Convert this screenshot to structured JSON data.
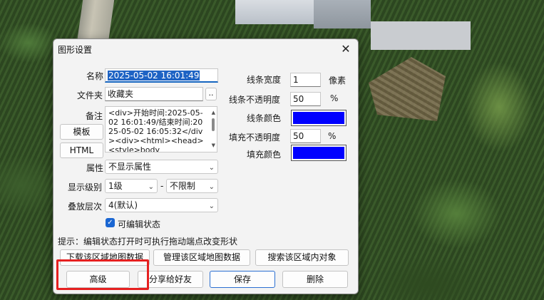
{
  "dialog": {
    "title": "图形设置",
    "close_glyph": "✕",
    "name_label": "名称",
    "name_value": "2025-05-02 16:01:49",
    "folder_label": "文件夹",
    "folder_value": "收藏夹",
    "folder_browse": "..",
    "note_label": "备注",
    "note_value": "<div>开始时间:2025-05-02 16:01:49/结束时间:2025-05-02 16:05:32</div><div><html><head><style>body",
    "template_button": "模板",
    "html_button": "HTML",
    "attr_label": "属性",
    "attr_value": "不显示属性",
    "level_label": "显示级别",
    "level_min": "1级",
    "level_sep": "-",
    "level_max": "不限制",
    "stack_label": "叠放层次",
    "stack_value": "4(默认)",
    "editable_label": "可编辑状态",
    "editable_checked": true,
    "line_width_label": "线条宽度",
    "line_width_value": "1",
    "line_width_unit": "像素",
    "line_opacity_label": "线条不透明度",
    "line_opacity_value": "50",
    "line_opacity_unit": "%",
    "line_color_label": "线条颜色",
    "line_color": "#0000ff",
    "fill_opacity_label": "填充不透明度",
    "fill_opacity_value": "50",
    "fill_opacity_unit": "%",
    "fill_color_label": "填充颜色",
    "fill_color": "#0000ff",
    "hint": "提示：编辑状态打开时可执行拖动端点改变形状",
    "download_button": "下载该区域地图数据",
    "manage_button": "管理该区域地图数据",
    "search_button": "搜索该区域内对象",
    "advanced_button": "高级",
    "share_button": "分享给好友",
    "save_button": "保存",
    "delete_button": "删除"
  },
  "icons": {
    "close": "close-icon",
    "chevron": "chevron-down-icon",
    "check": "checkmark-icon"
  },
  "highlight_color": "#e62020"
}
